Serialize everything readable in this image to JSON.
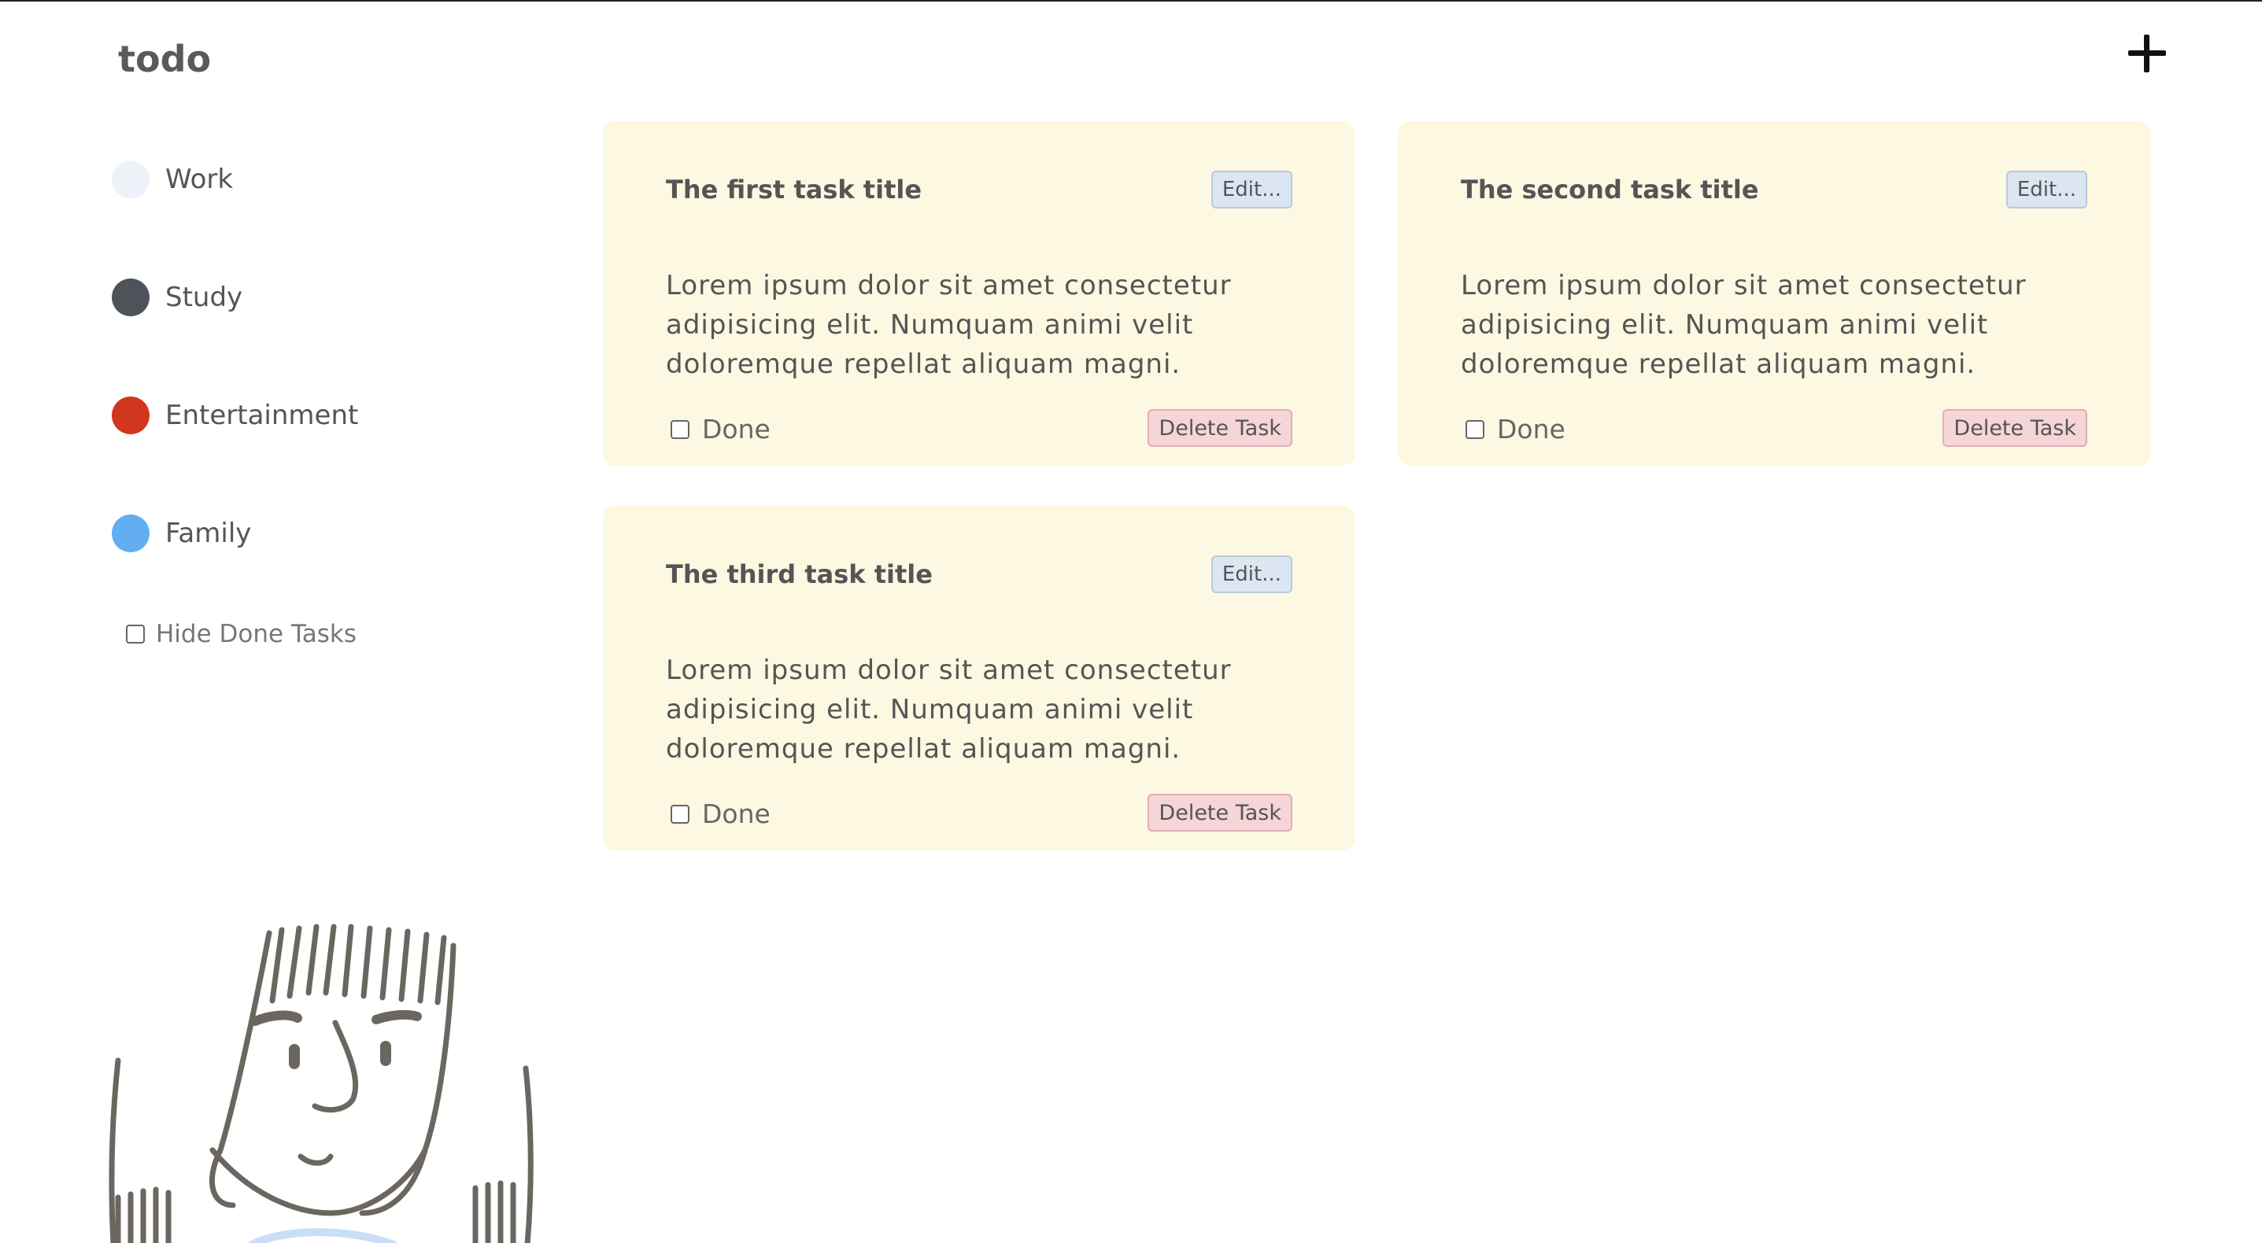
{
  "header": {
    "title": "todo",
    "add_icon": "plus-icon"
  },
  "sidebar": {
    "categories": [
      {
        "label": "Work",
        "color": "#edf2f9"
      },
      {
        "label": "Study",
        "color": "#4e5259"
      },
      {
        "label": "Entertainment",
        "color": "#d1361f"
      },
      {
        "label": "Family",
        "color": "#63aef1"
      }
    ],
    "hide_done_label": "Hide Done Tasks",
    "hide_done_checked": false
  },
  "tasks": [
    {
      "title": "The first task title",
      "edit_label": "Edit...",
      "description": "Lorem ipsum dolor sit amet consectetur adipisicing elit. Numquam animi velit doloremque repellat aliquam magni.",
      "done_label": "Done",
      "done": false,
      "delete_label": "Delete Task"
    },
    {
      "title": "The second task title",
      "edit_label": "Edit...",
      "description": "Lorem ipsum dolor sit amet consectetur adipisicing elit. Numquam animi velit doloremque repellat aliquam magni.",
      "done_label": "Done",
      "done": false,
      "delete_label": "Delete Task"
    },
    {
      "title": "The third task title",
      "edit_label": "Edit...",
      "description": "Lorem ipsum dolor sit amet consectetur adipisicing elit. Numquam animi velit doloremque repellat aliquam magni.",
      "done_label": "Done",
      "done": false,
      "delete_label": "Delete Task"
    }
  ],
  "colors": {
    "card_bg": "#fdf8e1",
    "edit_bg": "#dce6f2",
    "delete_bg": "#f5d5d8"
  }
}
